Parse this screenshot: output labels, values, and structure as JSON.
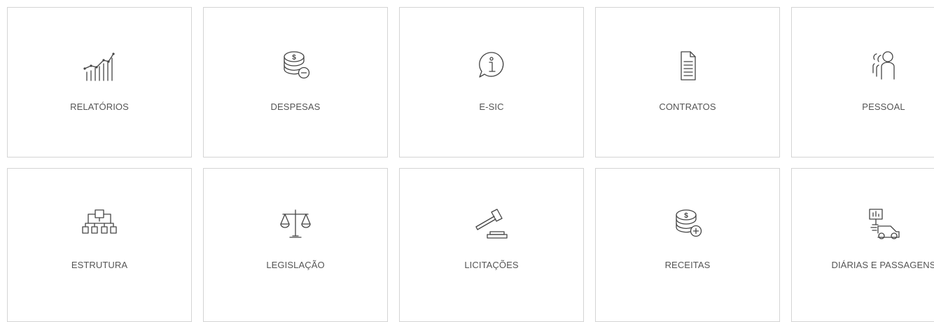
{
  "tiles": [
    {
      "label": "RELATÓRIOS",
      "icon": "bar-chart-icon"
    },
    {
      "label": "DESPESAS",
      "icon": "coins-minus-icon"
    },
    {
      "label": "E-SIC",
      "icon": "info-bubble-icon"
    },
    {
      "label": "CONTRATOS",
      "icon": "document-icon"
    },
    {
      "label": "PESSOAL",
      "icon": "people-icon"
    },
    {
      "label": "ESTRUTURA",
      "icon": "org-chart-icon"
    },
    {
      "label": "LEGISLAÇÃO",
      "icon": "scales-icon"
    },
    {
      "label": "LICITAÇÕES",
      "icon": "gavel-icon"
    },
    {
      "label": "RECEITAS",
      "icon": "coins-plus-icon"
    },
    {
      "label": "DIÁRIAS E PASSAGENS",
      "icon": "travel-icon"
    }
  ],
  "colors": {
    "border": "#d4d4d4",
    "icon": "#444444",
    "text": "#555555"
  }
}
